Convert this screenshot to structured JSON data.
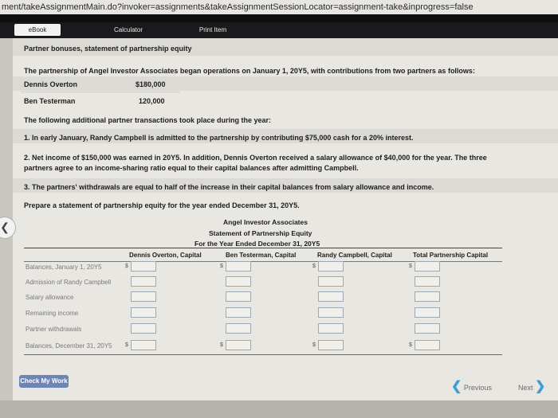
{
  "browser": {
    "url": "ment/takeAssignmentMain.do?invoker=assignments&takeAssignmentSessionLocator=assignment-take&inprogress=false"
  },
  "tabs": [
    "eBook",
    "Calculator",
    "Print Item"
  ],
  "problem": {
    "title": "Partner bonuses, statement of partnership equity",
    "intro": "The partnership of Angel Investor Associates began operations on January 1, 20Y5, with contributions from two partners as follows:",
    "partners": [
      {
        "name": "Dennis Overton",
        "amount": "$180,000"
      },
      {
        "name": "Ben Testerman",
        "amount": "120,000"
      }
    ],
    "transactions_heading": "The following additional partner transactions took place during the year:",
    "item1": "1. In early January, Randy Campbell is admitted to the partnership by contributing $75,000 cash for a 20% interest.",
    "item2_line1": "2. Net income of $150,000 was earned in 20Y5. In addition, Dennis Overton received a salary allowance of $40,000 for the year. The three",
    "item2_line2": "partners agree to an income-sharing ratio equal to their capital balances after admitting Campbell.",
    "item3": "3. The partners' withdrawals are equal to half of the increase in their capital balances from salary allowance and income.",
    "instruction": "Prepare a statement of partnership equity for the year ended December 31, 20Y5."
  },
  "statement": {
    "company": "Angel Investor Associates",
    "title": "Statement of Partnership Equity",
    "period": "For the Year Ended December 31, 20Y5",
    "columns": [
      "Dennis Overton, Capital",
      "Ben Testerman, Capital",
      "Randy Campbell, Capital",
      "Total Partnership Capital"
    ],
    "rows": [
      "Balances, January 1, 20Y5",
      "Admission of Randy Campbell",
      "Salary allowance",
      "Remaining income",
      "Partner withdrawals",
      "Balances, December 31, 20Y5"
    ],
    "currency": "$"
  },
  "footer": {
    "check_label": "Check My Work",
    "previous_label": "Previous",
    "next_label": "Next"
  }
}
